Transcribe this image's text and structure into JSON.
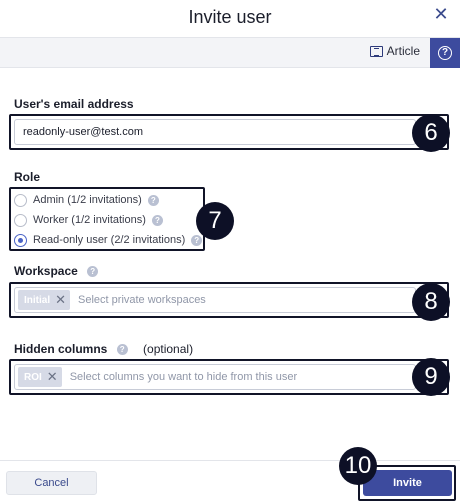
{
  "dialog": {
    "title": "Invite user",
    "close_icon": "close-icon"
  },
  "toolbar": {
    "article_label": "Article",
    "article_icon": "article-icon",
    "help_icon": "help-icon"
  },
  "email": {
    "label": "User's email address",
    "value": "readonly-user@test.com"
  },
  "role": {
    "label": "Role",
    "options": [
      {
        "label": "Admin (1/2 invitations)",
        "selected": false
      },
      {
        "label": "Worker (1/2 invitations)",
        "selected": false
      },
      {
        "label": "Read-only user (2/2 invitations)",
        "selected": true
      }
    ]
  },
  "workspace": {
    "label": "Workspace",
    "chip": "Initial",
    "placeholder": "Select private workspaces"
  },
  "hidden_columns": {
    "label": "Hidden columns",
    "optional": "(optional)",
    "chip": "ROI",
    "placeholder": "Select columns you want to hide from this user"
  },
  "footer": {
    "cancel_label": "Cancel",
    "invite_label": "Invite"
  },
  "markers": [
    "6",
    "7",
    "8",
    "9",
    "10"
  ],
  "colors": {
    "primary": "#3d4b9e",
    "marker": "#0d1026"
  }
}
